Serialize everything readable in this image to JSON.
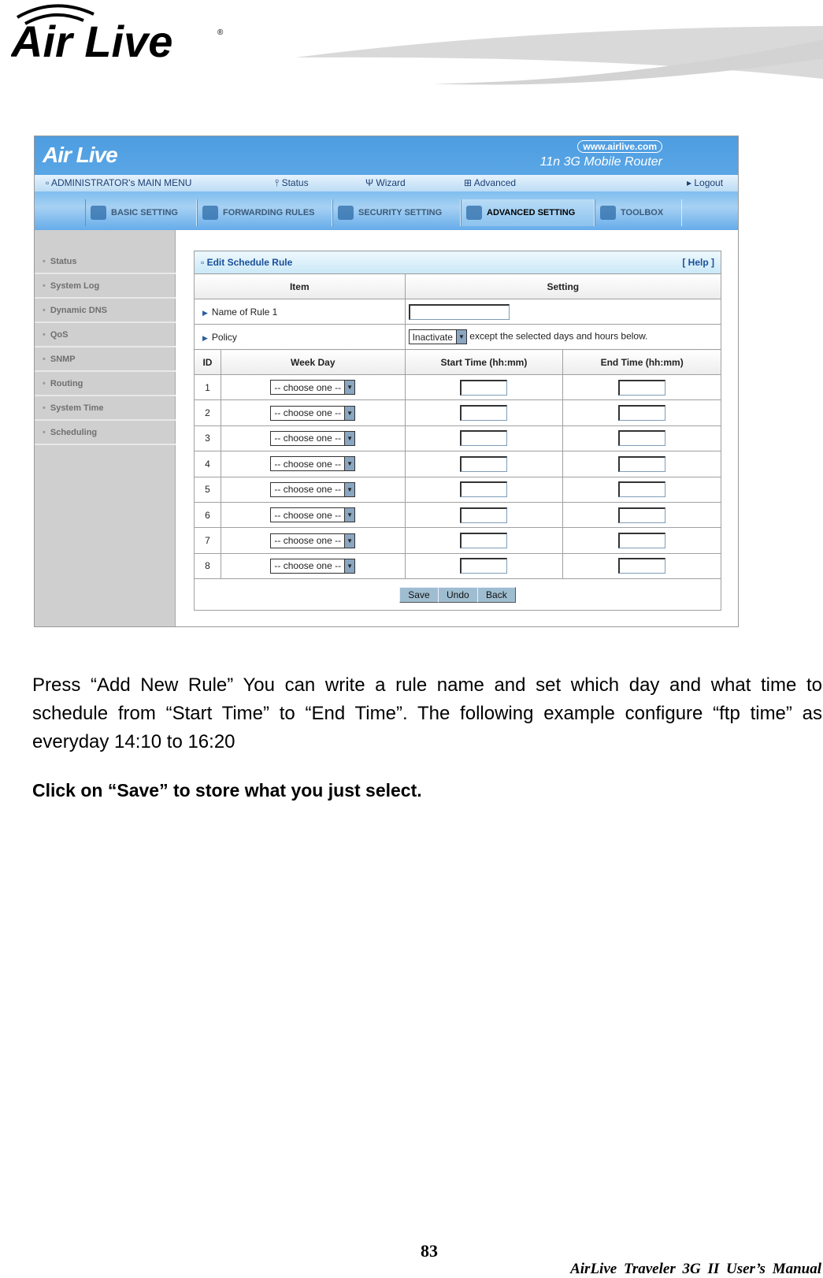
{
  "header": {
    "logo_text": "Air Live"
  },
  "router": {
    "brand": "Air Live",
    "url": "www.airlive.com",
    "model": "11n 3G Mobile Router",
    "menu": {
      "main": "ADMINISTRATOR's MAIN MENU",
      "status": "Status",
      "wizard": "Wizard",
      "advanced": "Advanced",
      "logout": "Logout"
    },
    "tabs": [
      {
        "label": "BASIC SETTING"
      },
      {
        "label": "FORWARDING RULES"
      },
      {
        "label": "SECURITY SETTING"
      },
      {
        "label": "ADVANCED SETTING",
        "active": true
      },
      {
        "label": "TOOLBOX"
      }
    ],
    "sidebar": [
      "Status",
      "System Log",
      "Dynamic DNS",
      "QoS",
      "SNMP",
      "Routing",
      "System Time",
      "Scheduling"
    ],
    "panel": {
      "title": "Edit Schedule Rule",
      "help": "[ Help ]",
      "col_item": "Item",
      "col_setting": "Setting",
      "name_label": "Name of Rule 1",
      "name_value": "",
      "policy_label": "Policy",
      "policy_value": "Inactivate",
      "policy_text": "except the selected days and hours below.",
      "col_id": "ID",
      "col_weekday": "Week Day",
      "col_start": "Start Time (hh:mm)",
      "col_end": "End Time (hh:mm)",
      "rows": [
        {
          "id": "1",
          "day": "-- choose one --"
        },
        {
          "id": "2",
          "day": "-- choose one --"
        },
        {
          "id": "3",
          "day": "-- choose one --"
        },
        {
          "id": "4",
          "day": "-- choose one --"
        },
        {
          "id": "5",
          "day": "-- choose one --"
        },
        {
          "id": "6",
          "day": "-- choose one --"
        },
        {
          "id": "7",
          "day": "-- choose one --"
        },
        {
          "id": "8",
          "day": "-- choose one --"
        }
      ],
      "buttons": {
        "save": "Save",
        "undo": "Undo",
        "back": "Back"
      }
    },
    "colors": {
      "header_blue": "#4d9de0",
      "sidebar_gray": "#cfcfcf",
      "button": "#9fbdd0"
    }
  },
  "body": {
    "paragraph": "Press “Add New Rule” You can write a rule name and set which day and what time to schedule from “Start Time” to “End Time”. The following example configure “ftp time” as everyday 14:10 to 16:20",
    "instruction": "Click on “Save” to store what you just select."
  },
  "footer": {
    "page": "83",
    "manual": "AirLive Traveler 3G II User’s Manual"
  }
}
